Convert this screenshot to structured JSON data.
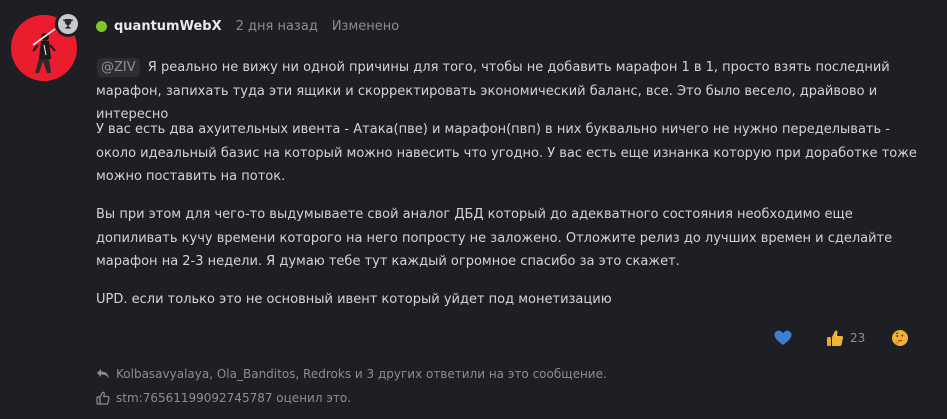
{
  "post": {
    "username": "quantumWebX",
    "timestamp": "2 дня назад",
    "edited": "Изменено",
    "mention": "@ZIV",
    "paragraphs": [
      "Я реально не вижу ни одной причины для того, чтобы не добавить марафон 1 в 1, просто взять последний марафон, запихать туда эти ящики и скорректировать экономический баланс, все. Это было весело, драйвово и интересно",
      "У вас есть два ахуительных ивента - Атака(пве) и марафон(пвп) в них буквально ничего не нужно переделывать - около идеальный базис на который можно навесить что угодно. У вас есть еще изнанка которую при доработке тоже можно поставить на поток.",
      "Вы при этом для чего-то выдумываете свой аналог ДБД который до адекватного состояния необходимо еще допиливать кучу времени которого на него попросту не заложено. Отложите релиз до лучших времен и сделайте марафон на 2-3 недели. Я думаю тебе тут каждый огромное спасибо за это скажет.",
      "UPD. если только это не основный ивент который уйдет под монетизацию"
    ]
  },
  "reactions": {
    "like_count": "23"
  },
  "footer": {
    "replies_text": "Kolbasavyalaya, Ola_Banditos, Redroks и 3 других ответили на это сообщение.",
    "liked_text": "stm:76561199092745787 оценил это."
  },
  "colors": {
    "background": "#1e1f24",
    "online": "#7cc62a",
    "avatar_bg": "#ea1c2d",
    "heart": "#3d7fd4",
    "emoji": "#f2b233"
  }
}
